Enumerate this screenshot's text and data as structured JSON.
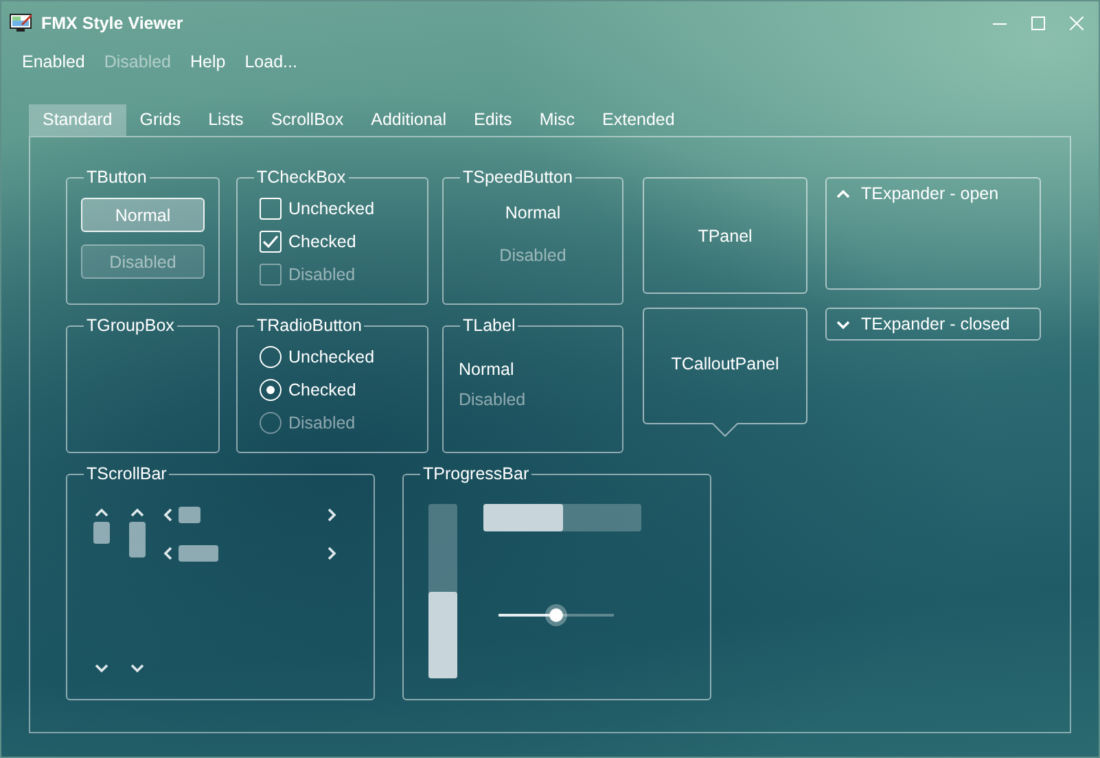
{
  "window": {
    "title": "FMX Style Viewer"
  },
  "menu": [
    {
      "label": "Enabled",
      "disabled": false
    },
    {
      "label": "Disabled",
      "disabled": true
    },
    {
      "label": "Help",
      "disabled": false
    },
    {
      "label": "Load...",
      "disabled": false
    }
  ],
  "tabs": [
    {
      "label": "Standard",
      "selected": true
    },
    {
      "label": "Grids",
      "selected": false
    },
    {
      "label": "Lists",
      "selected": false
    },
    {
      "label": "ScrollBox",
      "selected": false
    },
    {
      "label": "Additional",
      "selected": false
    },
    {
      "label": "Edits",
      "selected": false
    },
    {
      "label": "Misc",
      "selected": false
    },
    {
      "label": "Extended",
      "selected": false
    }
  ],
  "button_group": {
    "title": "TButton",
    "buttons": [
      {
        "label": "Normal",
        "disabled": false
      },
      {
        "label": "Disabled",
        "disabled": true
      }
    ]
  },
  "checkbox_group": {
    "title": "TCheckBox",
    "items": [
      {
        "label": "Unchecked",
        "checked": false,
        "disabled": false
      },
      {
        "label": "Checked",
        "checked": true,
        "disabled": false
      },
      {
        "label": "Disabled",
        "checked": false,
        "disabled": true
      }
    ]
  },
  "speedbutton_group": {
    "title": "TSpeedButton",
    "buttons": [
      {
        "label": "Normal",
        "disabled": false
      },
      {
        "label": "Disabled",
        "disabled": true
      }
    ]
  },
  "plain_group": {
    "title": "TGroupBox"
  },
  "radio_group": {
    "title": "TRadioButton",
    "items": [
      {
        "label": "Unchecked",
        "selected": false,
        "disabled": false
      },
      {
        "label": "Checked",
        "selected": true,
        "disabled": false
      },
      {
        "label": "Disabled",
        "selected": false,
        "disabled": true
      }
    ]
  },
  "label_group": {
    "title": "TLabel",
    "labels": [
      {
        "text": "Normal",
        "disabled": false
      },
      {
        "text": "Disabled",
        "disabled": true
      }
    ]
  },
  "panel": {
    "text": "TPanel"
  },
  "callout_panel": {
    "text": "TCalloutPanel"
  },
  "expanders": [
    {
      "title": "TExpander - open",
      "expanded": true
    },
    {
      "title": "TExpander - closed",
      "expanded": false
    }
  ],
  "scrollbar_group": {
    "title": "TScrollBar"
  },
  "progress_group": {
    "title": "TProgressBar",
    "vertical": {
      "level": 0.5
    },
    "horizontal": {
      "level": 0.5
    },
    "slider": {
      "level": 0.5
    }
  }
}
